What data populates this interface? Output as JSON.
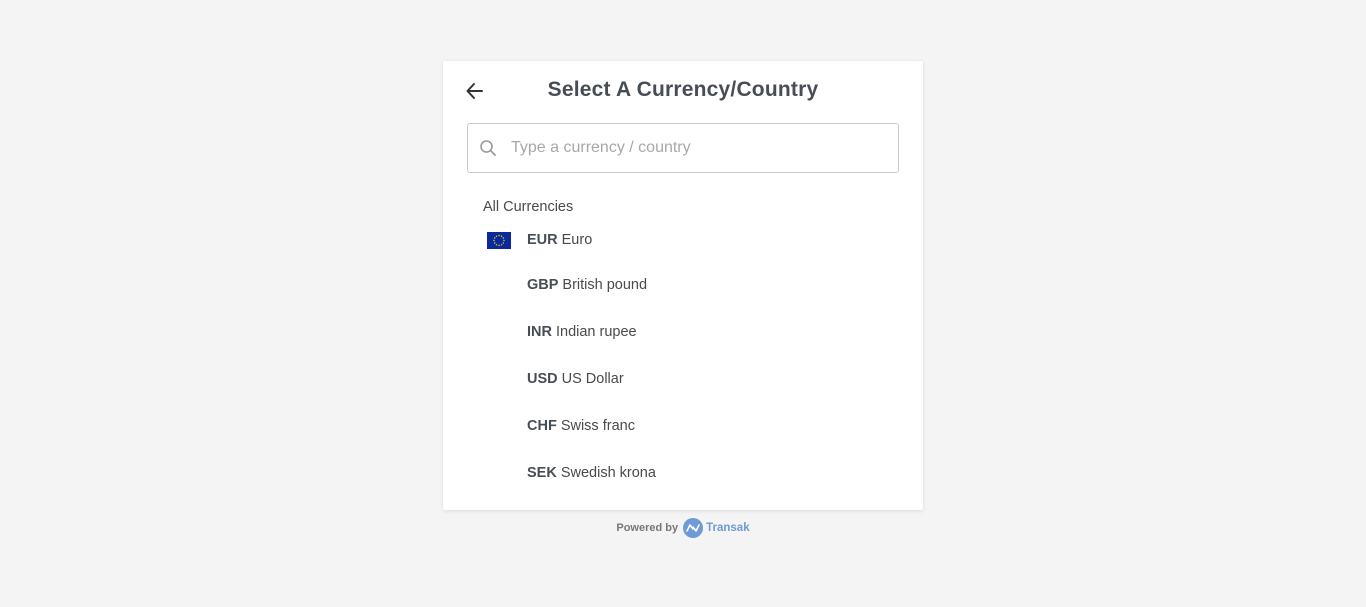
{
  "header": {
    "title": "Select A Currency/Country",
    "back_icon": "arrow-left-icon"
  },
  "search": {
    "placeholder": "Type a currency / country",
    "value": "",
    "icon": "search-icon"
  },
  "list": {
    "section_label": "All Currencies",
    "items": [
      {
        "code": "EUR",
        "name": "Euro",
        "flag": "eu-flag-icon"
      },
      {
        "code": "GBP",
        "name": "British pound",
        "flag": ""
      },
      {
        "code": "INR",
        "name": "Indian rupee",
        "flag": ""
      },
      {
        "code": "USD",
        "name": "US Dollar",
        "flag": ""
      },
      {
        "code": "CHF",
        "name": "Swiss franc",
        "flag": ""
      },
      {
        "code": "SEK",
        "name": "Swedish krona",
        "flag": ""
      }
    ]
  },
  "footer": {
    "powered_by": "Powered by",
    "brand": "Transak",
    "brand_color": "#6e9ad6"
  },
  "colors": {
    "background": "#f4f4f4",
    "card": "#ffffff",
    "title": "#474d57",
    "eu_flag": "#0a2a9b",
    "eu_stars": "#ffd700"
  }
}
